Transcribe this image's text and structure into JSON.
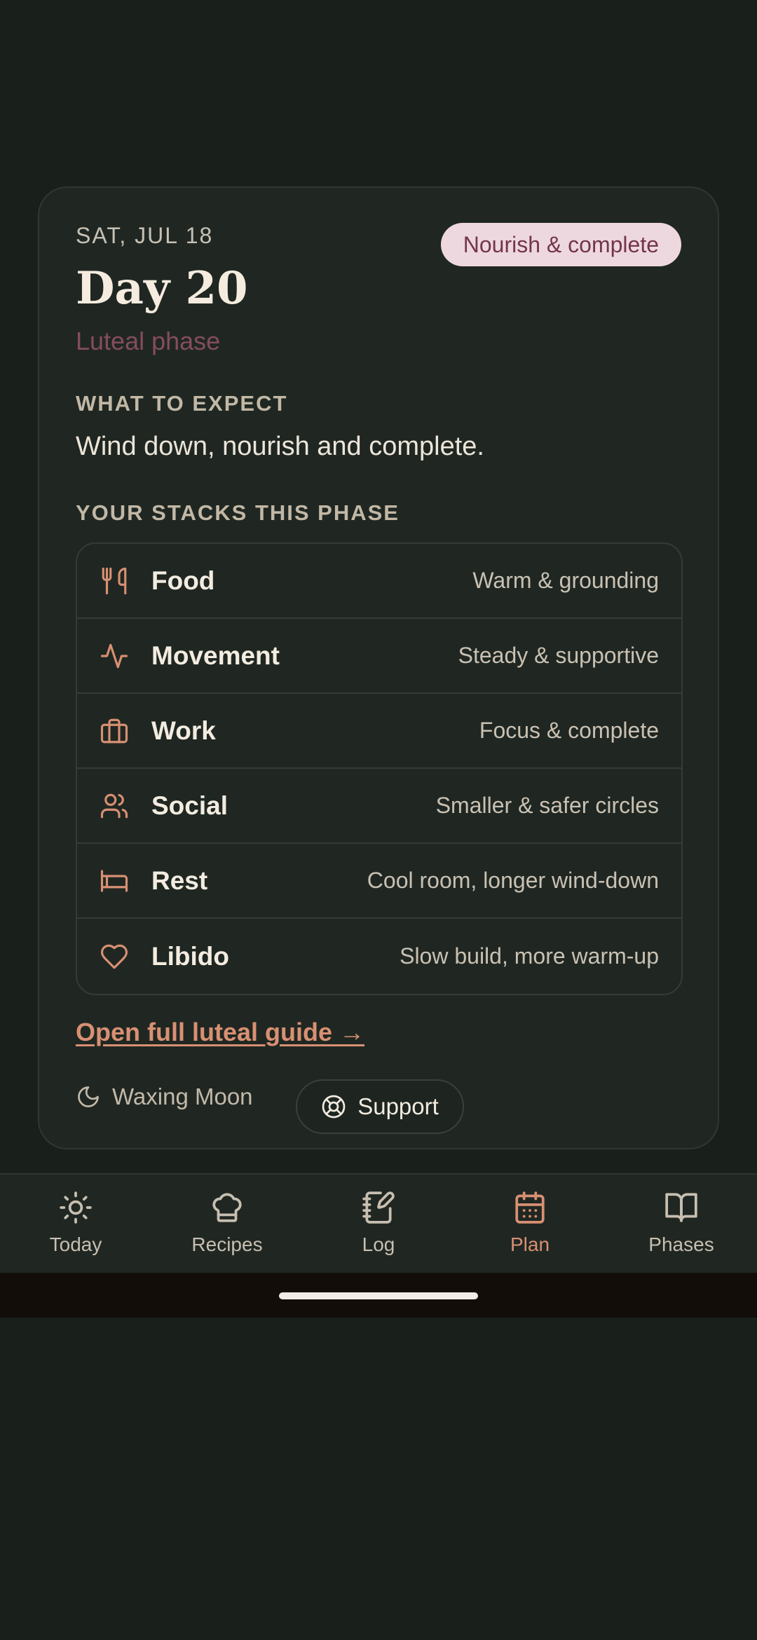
{
  "card": {
    "date": "SAT, JUL 18",
    "badge": "Nourish & complete",
    "day_title": "Day 20",
    "phase_name": "Luteal phase",
    "expect_label": "WHAT TO EXPECT",
    "expect_text": "Wind down, nourish and complete.",
    "stacks_label": "YOUR STACKS THIS PHASE",
    "stacks": [
      {
        "icon": "utensils-icon",
        "name": "Food",
        "desc": "Warm & grounding"
      },
      {
        "icon": "activity-icon",
        "name": "Movement",
        "desc": "Steady & supportive"
      },
      {
        "icon": "briefcase-icon",
        "name": "Work",
        "desc": "Focus & complete"
      },
      {
        "icon": "users-icon",
        "name": "Social",
        "desc": "Smaller & safer circles"
      },
      {
        "icon": "bed-icon",
        "name": "Rest",
        "desc": "Cool room, longer wind-down"
      },
      {
        "icon": "heart-icon",
        "name": "Libido",
        "desc": "Slow build, more warm-up"
      }
    ],
    "guide_link": "Open full luteal guide →",
    "moon": {
      "icon": "moon-icon",
      "text": "Waxing Moon"
    },
    "support": {
      "icon": "lifebuoy-icon",
      "label": "Support"
    }
  },
  "nav": {
    "items": [
      {
        "icon": "sun-icon",
        "label": "Today",
        "active": false
      },
      {
        "icon": "chef-hat-icon",
        "label": "Recipes",
        "active": false
      },
      {
        "icon": "notebook-pen-icon",
        "label": "Log",
        "active": false
      },
      {
        "icon": "calendar-icon",
        "label": "Plan",
        "active": true
      },
      {
        "icon": "book-open-icon",
        "label": "Phases",
        "active": false
      }
    ]
  },
  "colors": {
    "background": "#19201c",
    "card": "#202722",
    "accent": "#d89073",
    "badge_bg": "#eed8df",
    "badge_text": "#74364b",
    "phase_text": "#844d5d"
  }
}
